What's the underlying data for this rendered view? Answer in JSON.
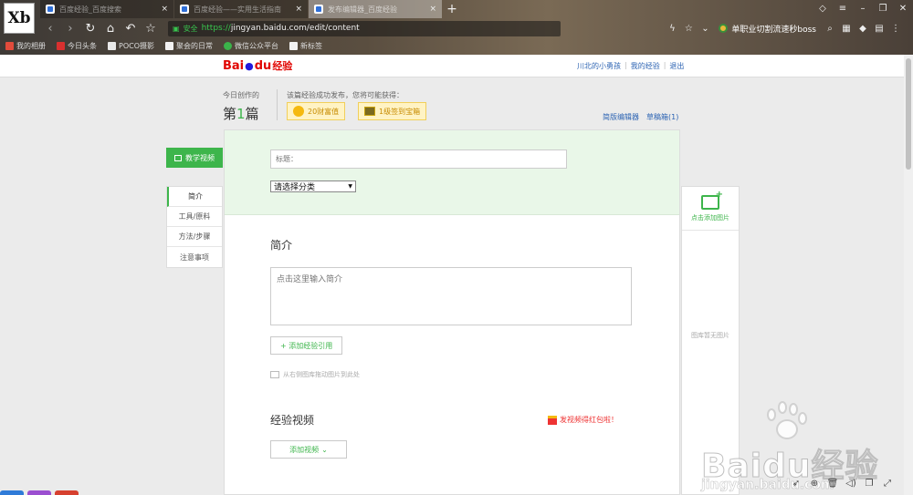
{
  "browser": {
    "app_logo_text": "Xb",
    "tabs": [
      {
        "label": "百度经验_百度搜索",
        "active": false
      },
      {
        "label": "百度经验——实用生活指南",
        "active": false
      },
      {
        "label": "发布编辑器_百度经验",
        "active": true
      }
    ],
    "new_tab_symbol": "+",
    "url_secure_label": "安全",
    "url_scheme": "https://",
    "url_rest": "jingyan.baidu.com/edit/content",
    "search_engine_label": "单职业切割流速秒boss",
    "bookmarks": [
      "我的相册",
      "今日头条",
      "POCO摄影",
      "聚会的日常",
      "微信公众平台",
      "新标签"
    ]
  },
  "site": {
    "logo_bai": "Bai",
    "logo_du": "du",
    "logo_jingyan": "经验",
    "user_links": [
      "川北的小勇孩",
      "我的经验",
      "退出"
    ],
    "today_label": "今日创作的",
    "today_count_prefix": "第",
    "today_count_num": "1",
    "today_count_suffix": "篇",
    "reward_tip": "该篇经验成功发布，您将可能获得：",
    "reward_wealth": "20财富值",
    "reward_treasure": "1级签到宝箱",
    "editor_links": [
      "简版编辑器",
      "草稿箱(1)"
    ]
  },
  "sidenav": {
    "video_label": "教学视频",
    "items": [
      "简介",
      "工具/原料",
      "方法/步骤",
      "注意事项"
    ]
  },
  "editor": {
    "title_placeholder": "标题：",
    "category_value": "请选择分类",
    "intro_title": "简介",
    "intro_placeholder": "点击这里输入简介",
    "add_reference": "+ 添加经验引用",
    "drag_tip": "从右侧图库拖动图片到此处",
    "video_title": "经验视频",
    "redpack_label": "发视频得红包啦！",
    "add_video": "添加视频"
  },
  "image_panel": {
    "add_image": "点击添加图片",
    "empty": "图库暂无图片"
  },
  "watermark": {
    "brand_bai": "Bai",
    "brand_du": "du",
    "brand_jingyan": "经验",
    "url": "jingyan.baidu.com"
  }
}
